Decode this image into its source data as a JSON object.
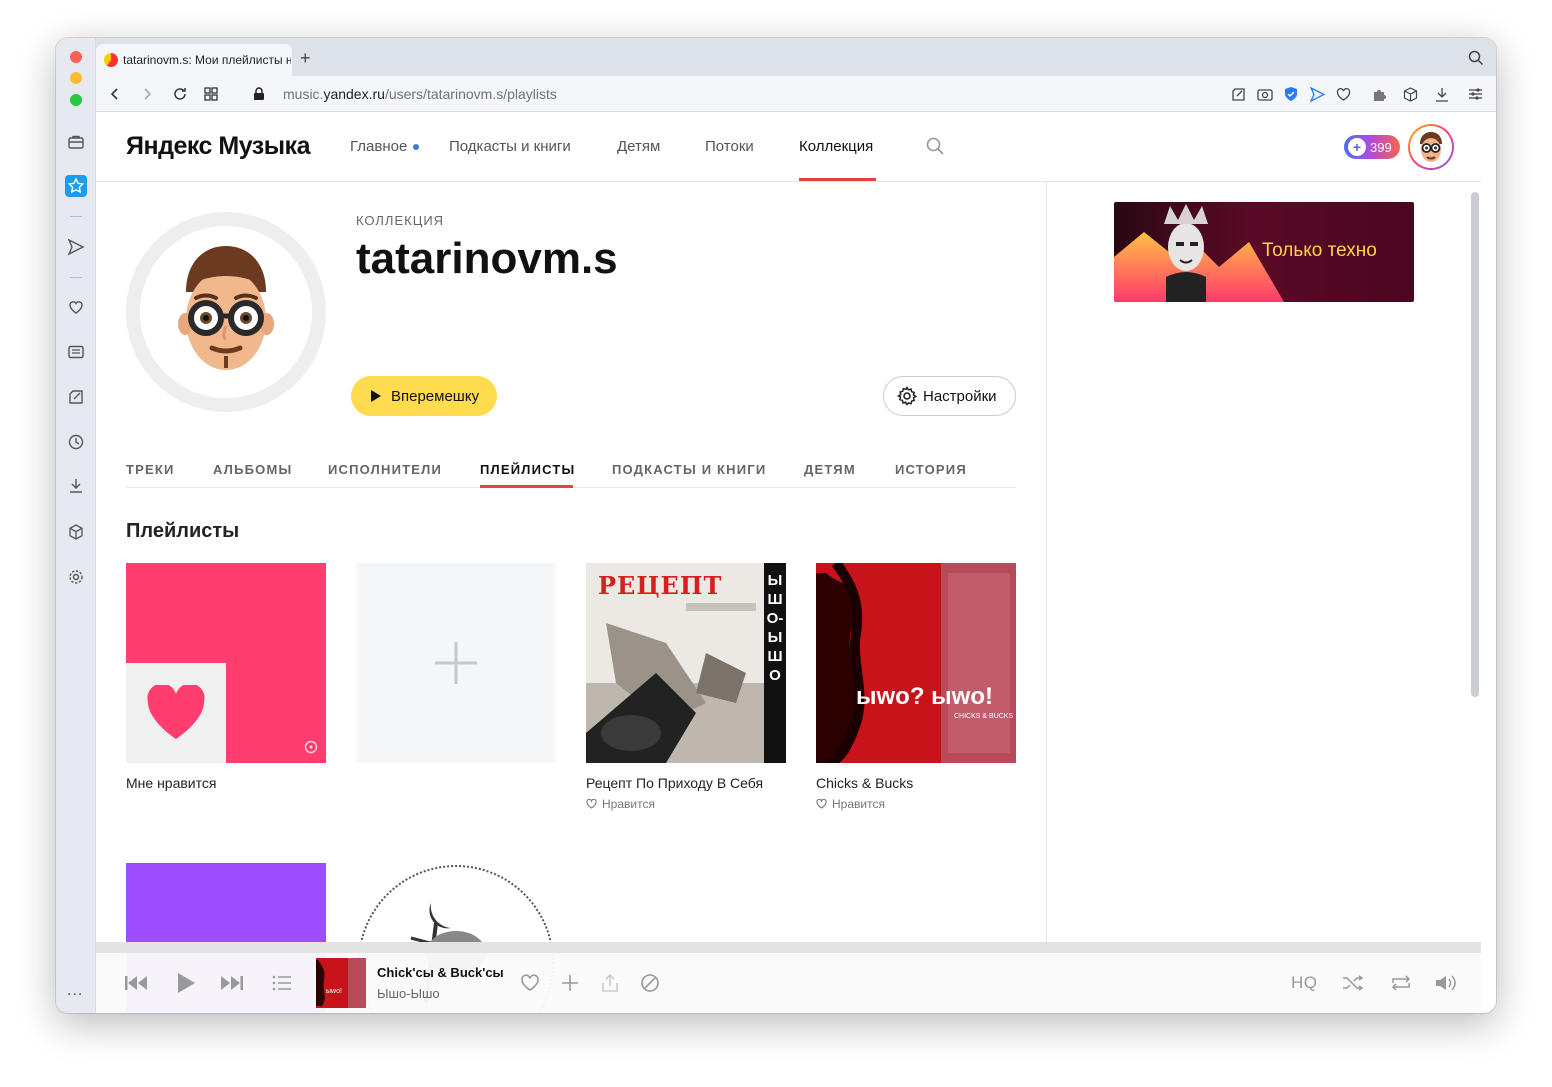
{
  "browser": {
    "tab_title": "tatarinovm.s: Мои плейлисты на Я",
    "new_tab": "+",
    "url_prefix": "music.",
    "url_domain": "yandex.ru",
    "url_path": "/users/tatarinovm.s/playlists"
  },
  "sidebar": {
    "more": "..."
  },
  "header": {
    "logo": "Яндекс Музыка",
    "nav": [
      "Главное",
      "Подкасты и книги",
      "Детям",
      "Потоки",
      "Коллекция"
    ],
    "active_nav": "Коллекция",
    "plus_points": "399"
  },
  "profile": {
    "caption": "КОЛЛЕКЦИЯ",
    "username": "tatarinovm.s",
    "shuffle_label": "Вперемешку",
    "settings_label": "Настройки"
  },
  "subtabs": [
    "ТРЕКИ",
    "АЛЬБОМЫ",
    "ИСПОЛНИТЕЛИ",
    "ПЛЕЙЛИСТЫ",
    "ПОДКАСТЫ И КНИГИ",
    "ДЕТЯМ",
    "ИСТОРИЯ"
  ],
  "active_subtab": "ПЛЕЙЛИСТЫ",
  "section_title": "Плейлисты",
  "playlists": [
    {
      "title": "Мне нравится",
      "sub": ""
    },
    {
      "title": "",
      "sub": ""
    },
    {
      "title": "Рецепт По Приходу В Себя",
      "sub": "Нравится",
      "cover_text": "РЕЦЕПТ",
      "cover_side": "ЫШО-ЫШО"
    },
    {
      "title": "Chicks & Bucks",
      "sub": "Нравится",
      "cover_text": "ыwo? ыwo!",
      "cover_small": "CHICKS & BUCKS"
    }
  ],
  "ad": {
    "text": "Только техно"
  },
  "player": {
    "track_title": "Chick'сы & Buck'сы",
    "track_artist": "Ышо-Ышо",
    "hq": "HQ"
  },
  "colors": {
    "accent_red": "#e54342",
    "shuffle_yellow": "#ffdb4d",
    "likes_pink": "#ff3d6f",
    "purple": "#9b4dff"
  }
}
